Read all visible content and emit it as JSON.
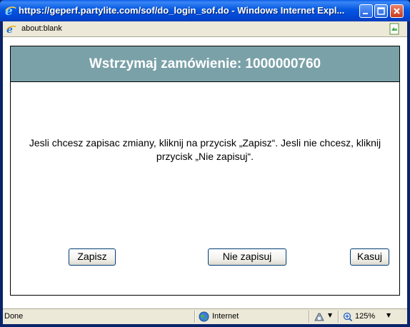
{
  "window": {
    "title": "https://geperf.partylite.com/sof/do_login_sof.do - Windows Internet Expl...",
    "controls": [
      "minimize",
      "maximize",
      "close"
    ]
  },
  "address_bar": {
    "url": "about:blank",
    "icons": [
      "ie-page-icon",
      "page-icon"
    ]
  },
  "dialog": {
    "title": "Wstrzymaj zamówienie: 1000000760",
    "message": "Jesli chcesz zapisac zmiany, kliknij na przycisk „Zapisz“. Jesli nie chcesz, kliknij przycisk „Nie zapisuj“.",
    "buttons": {
      "save": "Zapisz",
      "dont_save": "Nie zapisuj",
      "cancel": "Kasuj"
    },
    "colors": {
      "header_bg": "#7aa1a8",
      "header_text": "#ffffff"
    }
  },
  "status_bar": {
    "status": "Done",
    "zone": "Internet",
    "zoom": "125%",
    "icons": [
      "globe-icon",
      "security-icon",
      "zoom-icon"
    ]
  }
}
